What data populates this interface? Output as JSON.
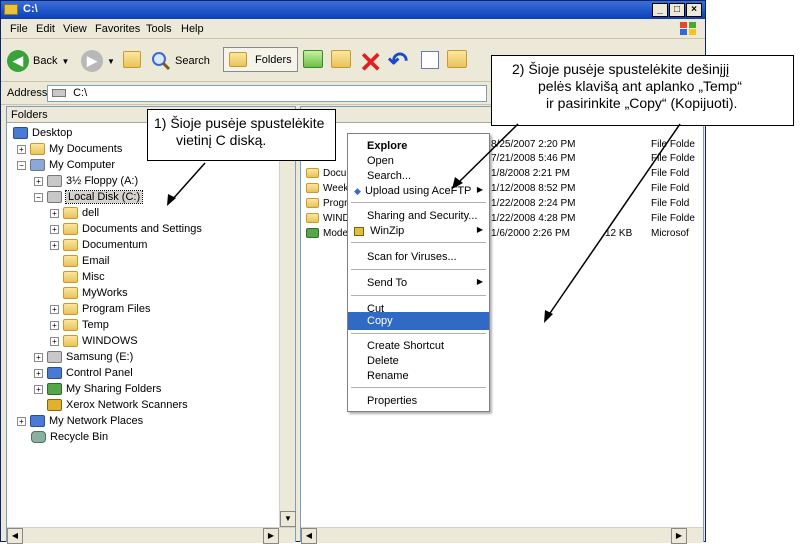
{
  "window": {
    "title": "C:\\"
  },
  "menu": [
    "File",
    "Edit",
    "View",
    "Favorites",
    "Tools",
    "Help"
  ],
  "toolbar": {
    "back": "Back",
    "search": "Search",
    "folders": "Folders"
  },
  "address": {
    "label": "Address",
    "value": "C:\\"
  },
  "folders_pane": {
    "header": "Folders",
    "items": [
      {
        "label": "Desktop"
      },
      {
        "label": "My Documents"
      },
      {
        "label": "My Computer"
      },
      {
        "label": "3½ Floppy (A:)"
      },
      {
        "label": "Local Disk (C:)"
      },
      {
        "label": "dell"
      },
      {
        "label": "Documents and Settings"
      },
      {
        "label": "Documentum"
      },
      {
        "label": "Email"
      },
      {
        "label": "Misc"
      },
      {
        "label": "MyWorks"
      },
      {
        "label": "Program Files"
      },
      {
        "label": "Temp"
      },
      {
        "label": "WINDOWS"
      },
      {
        "label": "Samsung (E:)"
      },
      {
        "label": "Control Panel"
      },
      {
        "label": "My Sharing Folders"
      },
      {
        "label": "Xerox Network Scanners"
      },
      {
        "label": "My Network Places"
      },
      {
        "label": "Recycle Bin"
      }
    ]
  },
  "files": [
    {
      "name": "",
      "date": "8/25/2007 2:20 PM",
      "size": "",
      "type": "File Folde"
    },
    {
      "name": "",
      "date": "7/21/2008 5:46 PM",
      "size": "",
      "type": "File Folde"
    },
    {
      "name": "Docum",
      "date": "1/8/2008 2:21 PM",
      "size": "",
      "type": "File Fold"
    },
    {
      "name": "Weekl",
      "date": "1/12/2008 8:52 PM",
      "size": "",
      "type": "File Fold"
    },
    {
      "name": "Progra",
      "date": "1/22/2008 2:24 PM",
      "size": "",
      "type": "File Fold"
    },
    {
      "name": "WINDO",
      "date": "1/22/2008 4:28 PM",
      "size": "",
      "type": "File Folde"
    },
    {
      "name": "Model",
      "date": "1/6/2000 2:26 PM",
      "size": "12 KB",
      "type": "Microsof"
    }
  ],
  "context_menu": {
    "explore": "Explore",
    "open": "Open",
    "search": "Search...",
    "upload": "Upload using AceFTP",
    "sharing": "Sharing and Security...",
    "winzip": "WinZip",
    "scan": "Scan for Viruses...",
    "send_to": "Send To",
    "cut": "Cut",
    "copy": "Copy",
    "create_shortcut": "Create Shortcut",
    "delete": "Delete",
    "rename": "Rename",
    "properties": "Properties"
  },
  "callouts": {
    "left": [
      "1) Šioje pusėje spustelėkite",
      "vietinį C diską."
    ],
    "right": [
      "2) Šioje pusėje spustelėkite dešinįjį",
      "pelės klavišą ant aplanko „Temp“",
      "ir pasirinkite „Copy“ (Kopijuoti)."
    ]
  }
}
